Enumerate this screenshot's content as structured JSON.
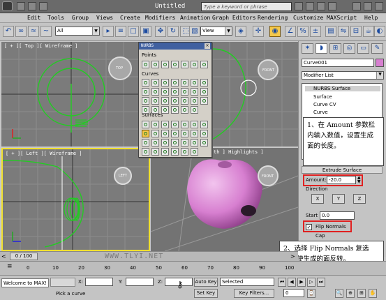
{
  "titlebar": {
    "title": "Untitled",
    "search_placeholder": "Type a keyword or phrase"
  },
  "menu": [
    "Edit",
    "Tools",
    "Group",
    "Views",
    "Create",
    "Modifiers",
    "Animation",
    "Graph Editors",
    "Rendering",
    "Customize",
    "MAXScript",
    "Help"
  ],
  "toolbar": {
    "selection_filter": "All",
    "ref_coord": "View"
  },
  "viewports": {
    "top": "[ + ][ Top ][ Wireframe ]",
    "front_label": "FRONT",
    "top_label": "TOP",
    "left": "[ + ][ Left ][ Wireframe ]",
    "perspective": "th ] Highlights ]",
    "left_cube": "LEFT",
    "persp_cube": "FRONT"
  },
  "nurbs_panel": {
    "title": "NURBS",
    "sections": [
      "Points",
      "Curves",
      "Surfaces"
    ]
  },
  "command_panel": {
    "object_name": "Curve001",
    "modifier_list": "Modifier List",
    "stack": [
      "NURBS Surface",
      "Surface",
      "Curve CV",
      "Curve"
    ],
    "rollout_title": "Extrude Surface",
    "amount_label": "Amount:",
    "amount_value": "-20.0",
    "direction_label": "Direction",
    "axes": [
      "X",
      "Y",
      "Z"
    ],
    "start_label": "Start",
    "start_value": "0.0",
    "flip_normals": "Flip Normals",
    "cap_label": "Cap"
  },
  "annotations": {
    "note1": "1、在 Amount 参数栏内输入数值，设置生成面的长度。",
    "note2": "2、选择 Flip Normals 复选框，使生成的面反转。"
  },
  "timeline": {
    "frame": "0 / 100",
    "ticks": [
      "0",
      "10",
      "20",
      "30",
      "40",
      "50",
      "60",
      "70",
      "80",
      "90",
      "100"
    ]
  },
  "statusbar": {
    "welcome": "Welcome to MAX!",
    "prompt": "Pick a curve",
    "x_label": "X:",
    "y_label": "Y:",
    "z_label": "Z:",
    "auto_key": "Auto Key",
    "set_key": "Set Key",
    "selected": "Selected",
    "key_filters": "Key Filters...",
    "frame_value": "0"
  },
  "watermark": "WWW.TLYI.NET",
  "colors": {
    "spline_green": "#22cc22",
    "apple_pink": "#d77fd0",
    "highlight_yellow": "#f0e030",
    "annotation_red": "#e02020"
  }
}
